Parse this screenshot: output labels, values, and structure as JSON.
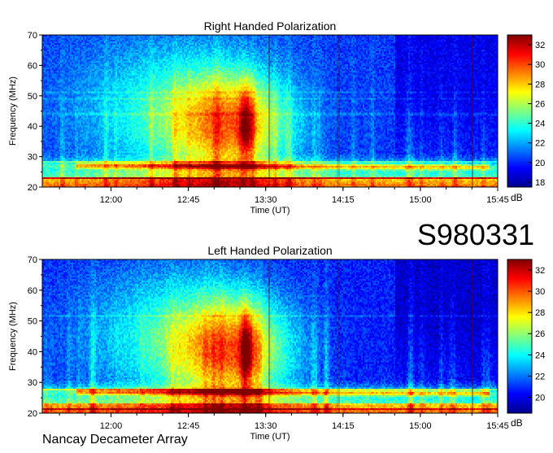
{
  "header_id": "S980331",
  "footer_label": "Nancay Decameter Array",
  "chart_data": [
    {
      "type": "heatmap",
      "title": "Right Handed Polarization",
      "xlabel": "Time (UT)",
      "ylabel": "Frequency (MHz)",
      "x_ticks": [
        "12:00",
        "12:45",
        "13:30",
        "14:15",
        "15:00",
        "15:45"
      ],
      "x_tick_minutes": [
        720,
        765,
        810,
        855,
        900,
        945
      ],
      "xlim_minutes": [
        680,
        945
      ],
      "y_ticks": [
        20,
        30,
        40,
        50,
        60,
        70
      ],
      "ylim": [
        20,
        70
      ],
      "colorbar": {
        "label": "dB",
        "ticks": [
          18,
          20,
          22,
          24,
          26,
          28,
          30,
          32
        ],
        "range": [
          17.5,
          33
        ]
      },
      "colormap": [
        "#00008f",
        "#0000ff",
        "#00ffff",
        "#ffff00",
        "#ff0000",
        "#800000"
      ]
    },
    {
      "type": "heatmap",
      "title": "Left Handed Polarization",
      "xlabel": "Time (UT)",
      "ylabel": "Frequency (MHz)",
      "x_ticks": [
        "12:00",
        "12:45",
        "13:30",
        "14:15",
        "15:00",
        "15:45"
      ],
      "x_tick_minutes": [
        720,
        765,
        810,
        855,
        900,
        945
      ],
      "xlim_minutes": [
        680,
        945
      ],
      "y_ticks": [
        20,
        30,
        40,
        50,
        60,
        70
      ],
      "ylim": [
        20,
        70
      ],
      "colorbar": {
        "label": "dB",
        "ticks": [
          20,
          22,
          24,
          26,
          28,
          30,
          32
        ],
        "range": [
          18.5,
          33
        ]
      },
      "colormap": [
        "#00008f",
        "#0000ff",
        "#00ffff",
        "#ffff00",
        "#ff0000",
        "#800000"
      ]
    }
  ]
}
